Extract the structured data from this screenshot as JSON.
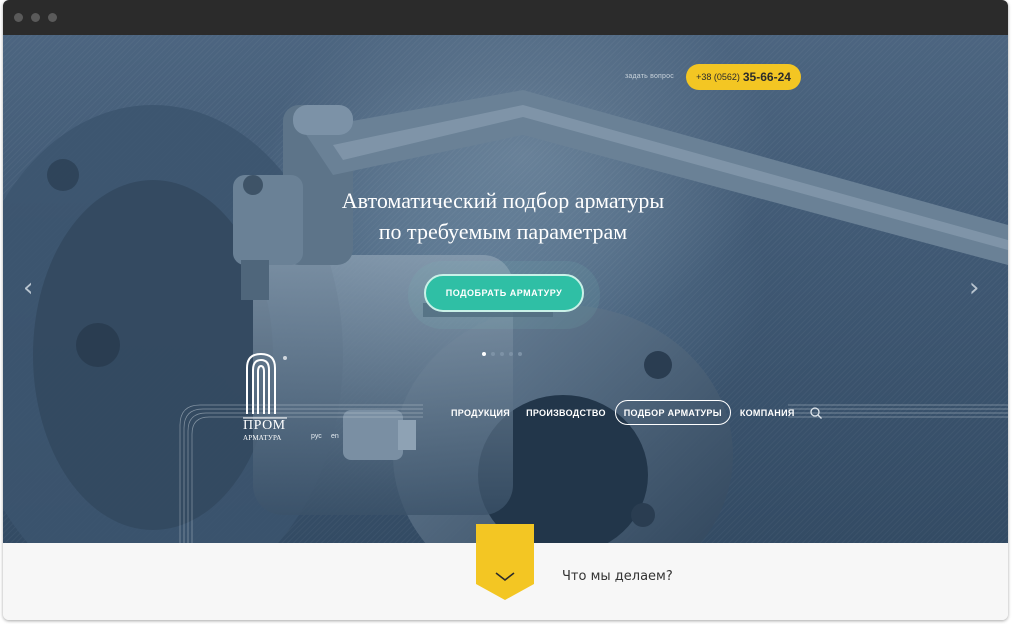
{
  "header": {
    "ask_link": "задать вопрос",
    "phone_prefix": "+38 (0562)",
    "phone_number": "35-66-24"
  },
  "slider": {
    "headline_line1": "Автоматический подбор арматуры",
    "headline_line2": "по требуемым параметрам",
    "cta_label": "ПОДОБРАТЬ АРМАТУРУ",
    "prev_icon": "chevron-left-icon",
    "next_icon": "chevron-right-icon",
    "slide_count": 5,
    "active_slide": 1
  },
  "logo": {
    "line1": "ПРОМ",
    "line2": "АРМАТУРА"
  },
  "lang": {
    "ru": "рус",
    "en": "en"
  },
  "nav": {
    "items": [
      {
        "label": "ПРОДУКЦИЯ"
      },
      {
        "label": "ПРОИЗВОДСТВО"
      },
      {
        "label": "ПОДБОР АРМАТУРЫ"
      },
      {
        "label": "КОМПАНИЯ"
      }
    ],
    "active_index": 2,
    "search_icon": "search-icon"
  },
  "section": {
    "title": "Что мы делаем?",
    "toggle_icon": "chevron-down-icon"
  },
  "colors": {
    "accent_yellow": "#f3c623",
    "cta_teal": "#2fbfa5",
    "hero_dark": "#334b64",
    "titlebar": "#2b2b2b"
  }
}
